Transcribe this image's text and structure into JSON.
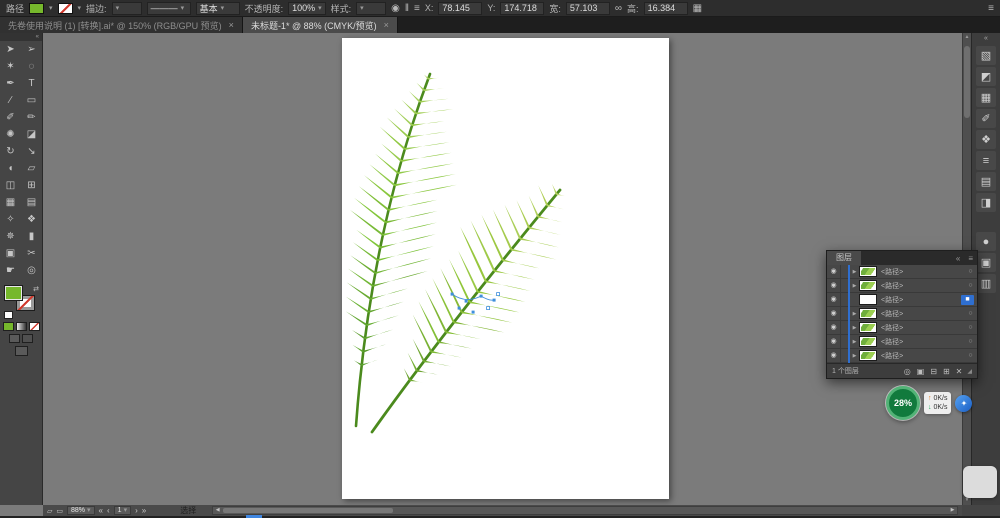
{
  "ui": {
    "caret": "▾",
    "up": "▲",
    "down": "▼",
    "left": "◀",
    "right": "▶",
    "collapse": "«",
    "menu": "≡",
    "resize": "◢",
    "swap": "⇄",
    "close": "×"
  },
  "control_bar": {
    "context_label": "路径",
    "stroke_label": "描边:",
    "width_profile_value": "———",
    "brush_value": "基本",
    "opacity_label": "不透明度:",
    "opacity_value": "100%",
    "style_label": "样式:",
    "recolor_glyph": "◉",
    "align_glyph": "‖",
    "distribute_glyph": "≡",
    "x_label": "X:",
    "x_value": "78.145",
    "y_label": "Y:",
    "y_value": "174.718",
    "w_label": "宽:",
    "w_value": "57.103",
    "link_glyph": "∞",
    "h_label": "高:",
    "h_value": "16.384",
    "transform_glyph": "▦"
  },
  "tabs": [
    {
      "title": "先卷使用说明 (1) [转换].ai* @ 150% (RGB/GPU 预览)"
    },
    {
      "title": "未标题-1* @ 88% (CMYK/预览)"
    }
  ],
  "toolbar": {
    "tools": [
      {
        "name": "selection-tool",
        "glyph": "➤"
      },
      {
        "name": "direct-selection-tool",
        "glyph": "➢"
      },
      {
        "name": "magic-wand-tool",
        "glyph": "✶"
      },
      {
        "name": "lasso-tool",
        "glyph": "◌"
      },
      {
        "name": "pen-tool",
        "glyph": "✒"
      },
      {
        "name": "type-tool",
        "glyph": "T"
      },
      {
        "name": "line-segment-tool",
        "glyph": "∕"
      },
      {
        "name": "rectangle-tool",
        "glyph": "▭"
      },
      {
        "name": "paintbrush-tool",
        "glyph": "✐"
      },
      {
        "name": "pencil-tool",
        "glyph": "✏"
      },
      {
        "name": "blob-brush-tool",
        "glyph": "✺"
      },
      {
        "name": "eraser-tool",
        "glyph": "◪"
      },
      {
        "name": "rotate-tool",
        "glyph": "↻"
      },
      {
        "name": "scale-tool",
        "glyph": "↘"
      },
      {
        "name": "width-tool",
        "glyph": "◖"
      },
      {
        "name": "free-transform-tool",
        "glyph": "▱"
      },
      {
        "name": "shape-builder-tool",
        "glyph": "◫"
      },
      {
        "name": "perspective-grid-tool",
        "glyph": "⊞"
      },
      {
        "name": "mesh-tool",
        "glyph": "▦"
      },
      {
        "name": "gradient-tool",
        "glyph": "▤"
      },
      {
        "name": "eyedropper-tool",
        "glyph": "✧"
      },
      {
        "name": "blend-tool",
        "glyph": "❖"
      },
      {
        "name": "symbol-sprayer-tool",
        "glyph": "✵"
      },
      {
        "name": "column-graph-tool",
        "glyph": "▮"
      },
      {
        "name": "artboard-tool",
        "glyph": "▣"
      },
      {
        "name": "slice-tool",
        "glyph": "✂"
      },
      {
        "name": "hand-tool",
        "glyph": "☛"
      },
      {
        "name": "zoom-tool",
        "glyph": "◎"
      }
    ],
    "fill_color": "#76b82c"
  },
  "dock": {
    "group1": [
      {
        "name": "color-panel-icon",
        "glyph": "▧"
      },
      {
        "name": "color-guide-panel-icon",
        "glyph": "◩"
      },
      {
        "name": "swatches-panel-icon",
        "glyph": "▦"
      },
      {
        "name": "brushes-panel-icon",
        "glyph": "✐"
      },
      {
        "name": "symbols-panel-icon",
        "glyph": "❖"
      },
      {
        "name": "stroke-panel-icon",
        "glyph": "≡"
      },
      {
        "name": "gradient-panel-icon",
        "glyph": "▤"
      },
      {
        "name": "transparency-panel-icon",
        "glyph": "◨"
      }
    ],
    "group2": [
      {
        "name": "appearance-panel-icon",
        "glyph": "●"
      },
      {
        "name": "graphic-styles-panel-icon",
        "glyph": "▣"
      },
      {
        "name": "layers-panel-icon",
        "glyph": "▥"
      }
    ]
  },
  "layers_panel": {
    "tab_label": "图层",
    "eye_glyph": "◉",
    "rows": [
      {
        "name": "<路径>",
        "expand": "▶",
        "thumb": "leaf",
        "target": "○",
        "selected": false
      },
      {
        "name": "<路径>",
        "expand": "▶",
        "thumb": "leaf",
        "target": "○",
        "selected": false
      },
      {
        "name": "<路径>",
        "expand": "",
        "thumb": "blank",
        "target": "■",
        "selected": true
      },
      {
        "name": "<路径>",
        "expand": "▶",
        "thumb": "leaf",
        "target": "○",
        "selected": false
      },
      {
        "name": "<路径>",
        "expand": "▶",
        "thumb": "leaf",
        "target": "○",
        "selected": false
      },
      {
        "name": "<路径>",
        "expand": "▶",
        "thumb": "leaf",
        "target": "○",
        "selected": false
      },
      {
        "name": "<路径>",
        "expand": "▶",
        "thumb": "leaf",
        "target": "○",
        "selected": false
      }
    ],
    "footer_label": "1 个图层",
    "footer_icons": [
      {
        "name": "locate-object-icon",
        "glyph": "◎"
      },
      {
        "name": "make-clip-mask-icon",
        "glyph": "▣"
      },
      {
        "name": "new-sublayer-icon",
        "glyph": "⊟"
      },
      {
        "name": "new-layer-icon",
        "glyph": "⊞"
      },
      {
        "name": "delete-layer-icon",
        "glyph": "✕"
      }
    ]
  },
  "status_bar": {
    "icon_a": "▱",
    "icon_b": "▭",
    "zoom_value": "88%",
    "nav_first": "«",
    "nav_prev": "‹",
    "artboard_value": "1",
    "nav_next": "›",
    "nav_last": "»",
    "tool_label": "选择"
  },
  "overlay": {
    "progress_percent": "28%",
    "up_arrow": "↑",
    "up_speed": "0K/s",
    "down_arrow": "↓",
    "down_speed": "0K/s",
    "blue_glyph": "✦"
  }
}
